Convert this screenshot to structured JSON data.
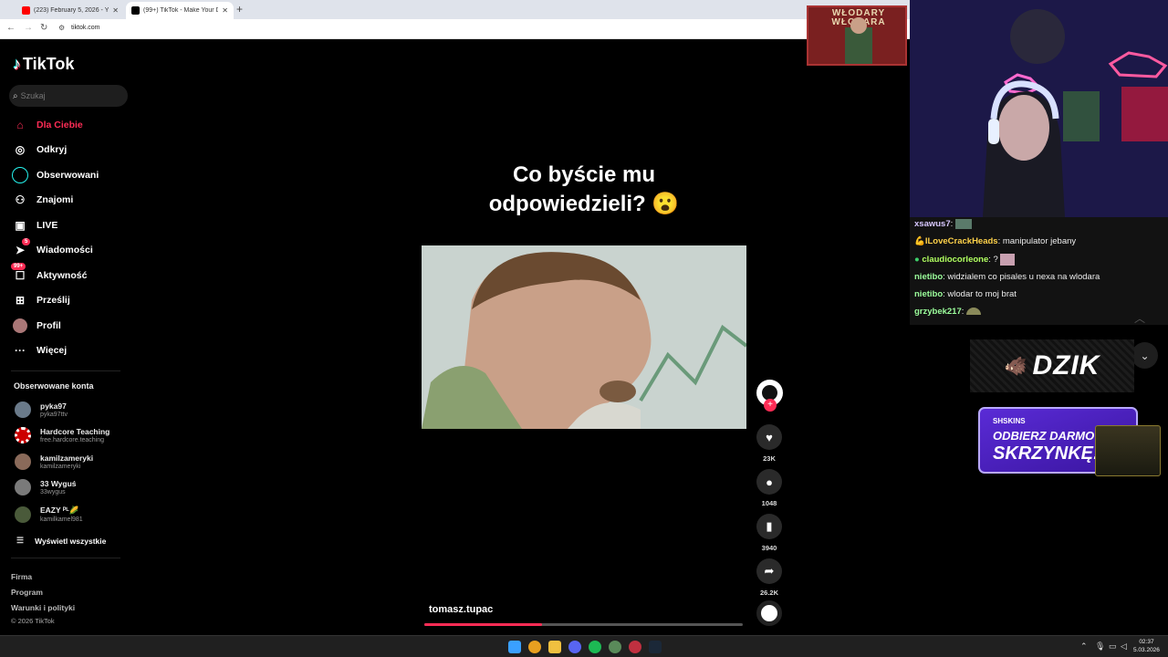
{
  "browser": {
    "tabs": [
      {
        "title": "(223) February 5, 2026 - YouTub",
        "favicon_color": "#ff0000"
      },
      {
        "title": "(99+) TikTok - Make Your Da",
        "favicon_color": "#000000"
      }
    ],
    "url": "tiktok.com"
  },
  "sidebar": {
    "brand": "TikTok",
    "search_placeholder": "Szukaj",
    "nav": [
      {
        "label": "Dla Ciebie",
        "icon": "home-icon",
        "active": true
      },
      {
        "label": "Odkryj",
        "icon": "compass-icon"
      },
      {
        "label": "Obserwowani",
        "icon": "following-icon"
      },
      {
        "label": "Znajomi",
        "icon": "friends-icon"
      },
      {
        "label": "LIVE",
        "icon": "live-icon"
      },
      {
        "label": "Wiadomości",
        "icon": "messages-icon",
        "badge": "5"
      },
      {
        "label": "Aktywność",
        "icon": "activity-icon",
        "badge": "99+"
      },
      {
        "label": "Prześlij",
        "icon": "upload-icon"
      },
      {
        "label": "Profil",
        "icon": "profile-icon"
      },
      {
        "label": "Więcej",
        "icon": "more-icon"
      }
    ],
    "following_title": "Obserwowane konta",
    "accounts": [
      {
        "name": "pyka97",
        "handle": "pyka97ttv"
      },
      {
        "name": "Hardcore Teaching",
        "handle": "free.hardcore.teaching"
      },
      {
        "name": "kamilzameryki",
        "handle": "kamilzameryki"
      },
      {
        "name": "33 Wyguś",
        "handle": "33wygus"
      },
      {
        "name": "EAZY ᴾᴸ🌽",
        "handle": "kamilkamel981"
      }
    ],
    "show_all": "Wyświetl wszystkie",
    "footer": [
      "Firma",
      "Program",
      "Warunki i polityki"
    ],
    "copyright": "© 2026 TikTok"
  },
  "video": {
    "caption_line1": "Co byście mu",
    "caption_line2": "odpowiedzieli? 😮",
    "author": "tomasz.tupac",
    "progress": 0.37,
    "likes": "23K",
    "comments": "1048",
    "saves": "3940",
    "shares": "26.2K"
  },
  "overlay": {
    "poster_text": "WŁODARY WŁODARA",
    "chat": [
      {
        "user": "xsawus7",
        "color": "#d8c8ff",
        "msg": ""
      },
      {
        "user": "ILoveCrackHeads",
        "color": "#ffd24a",
        "msg": "manipulator jebany"
      },
      {
        "user": "claudiocorleone",
        "color": "#b0ff60",
        "msg": "?"
      },
      {
        "user": "nietibo",
        "color": "#9cff9c",
        "msg": "widzialem co pisales u nexa na wlodara"
      },
      {
        "user": "nietibo",
        "color": "#9cff9c",
        "msg": "wlodar to moj brat"
      },
      {
        "user": "grzybek217",
        "color": "#9cff9c",
        "msg": ""
      }
    ],
    "sponsor1": "DZIK",
    "sponsor2_brand": "SHSKINS",
    "sponsor2_line1": "ODBIERZ DARMOWĄ",
    "sponsor2_line2": "SKRZYNKĘ!"
  },
  "taskbar": {
    "time": "02:37",
    "date": "5.03.2026"
  }
}
